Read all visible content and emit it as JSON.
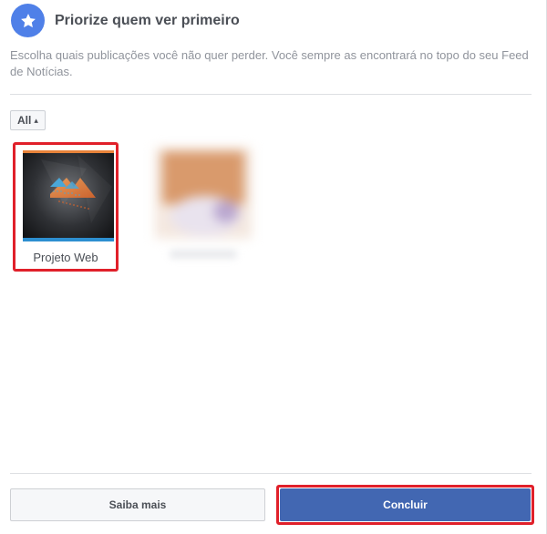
{
  "header": {
    "title": "Priorize quem ver primeiro",
    "icon": "star-icon",
    "accent_color": "#4f80e8"
  },
  "description": "Escolha quais publicações você não quer perder. Você sempre as encontrará no topo do seu Feed de Notícias.",
  "filter": {
    "selected": "All"
  },
  "items": [
    {
      "label": "Projeto Web",
      "selected": true
    },
    {
      "label": "",
      "blurred": true
    }
  ],
  "buttons": {
    "secondary_label": "Saiba mais",
    "primary_label": "Concluir",
    "primary_color": "#4267b2",
    "highlight_color": "#e0202a"
  }
}
